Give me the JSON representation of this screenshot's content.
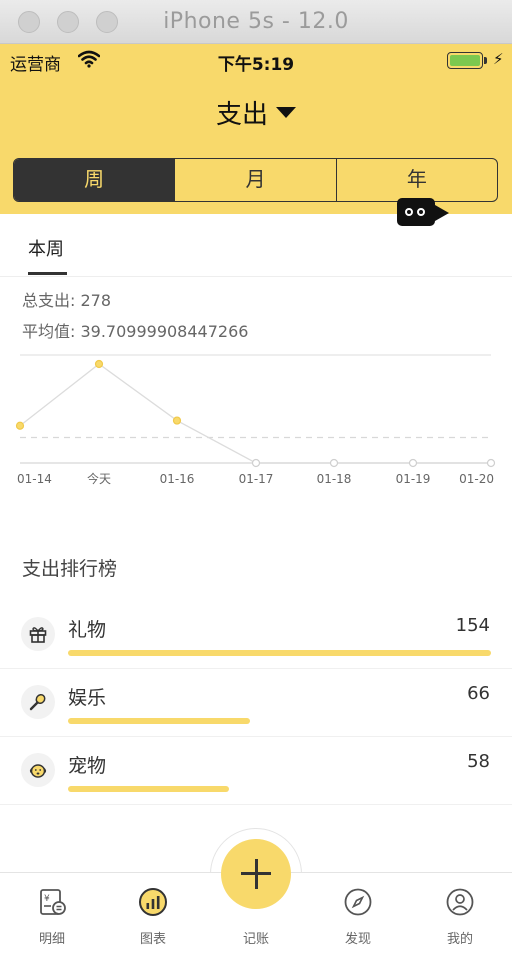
{
  "window": {
    "title": "iPhone 5s - 12.0"
  },
  "status_bar": {
    "carrier": "运营商",
    "time": "下午5:19"
  },
  "header": {
    "title": "支出"
  },
  "segments": [
    {
      "label": "周",
      "active": true
    },
    {
      "label": "月",
      "active": false
    },
    {
      "label": "年",
      "active": false
    }
  ],
  "tab": {
    "label": "本周"
  },
  "stats": {
    "total": "总支出: 278",
    "average": "平均值: 39.70999908447266"
  },
  "chart_data": {
    "type": "line",
    "categories": [
      "01-14",
      "今天",
      "01-16",
      "01-17",
      "01-18",
      "01-19",
      "01-20"
    ],
    "series": [
      {
        "values": [
          58,
          154,
          66,
          0,
          0,
          0,
          0
        ]
      }
    ],
    "average_line": 39.71,
    "ylim": [
      0,
      168
    ],
    "grid": true
  },
  "ranking": {
    "title": "支出排行榜",
    "items": [
      {
        "name": "礼物",
        "value": "154",
        "ratio": 1.0,
        "icon": "gift-icon"
      },
      {
        "name": "娱乐",
        "value": "66",
        "ratio": 0.43,
        "icon": "microphone-icon"
      },
      {
        "name": "宠物",
        "value": "58",
        "ratio": 0.38,
        "icon": "dog-icon"
      }
    ]
  },
  "bottom_nav": {
    "items": [
      {
        "label": "明细",
        "icon": "ledger-icon"
      },
      {
        "label": "图表",
        "icon": "chart-icon"
      },
      {
        "label": "记账",
        "icon": "plus-icon"
      },
      {
        "label": "发现",
        "icon": "compass-icon"
      },
      {
        "label": "我的",
        "icon": "profile-icon"
      }
    ]
  },
  "colors": {
    "accent": "#f8d96b",
    "dark": "#333333",
    "battery": "#7cc84f"
  }
}
